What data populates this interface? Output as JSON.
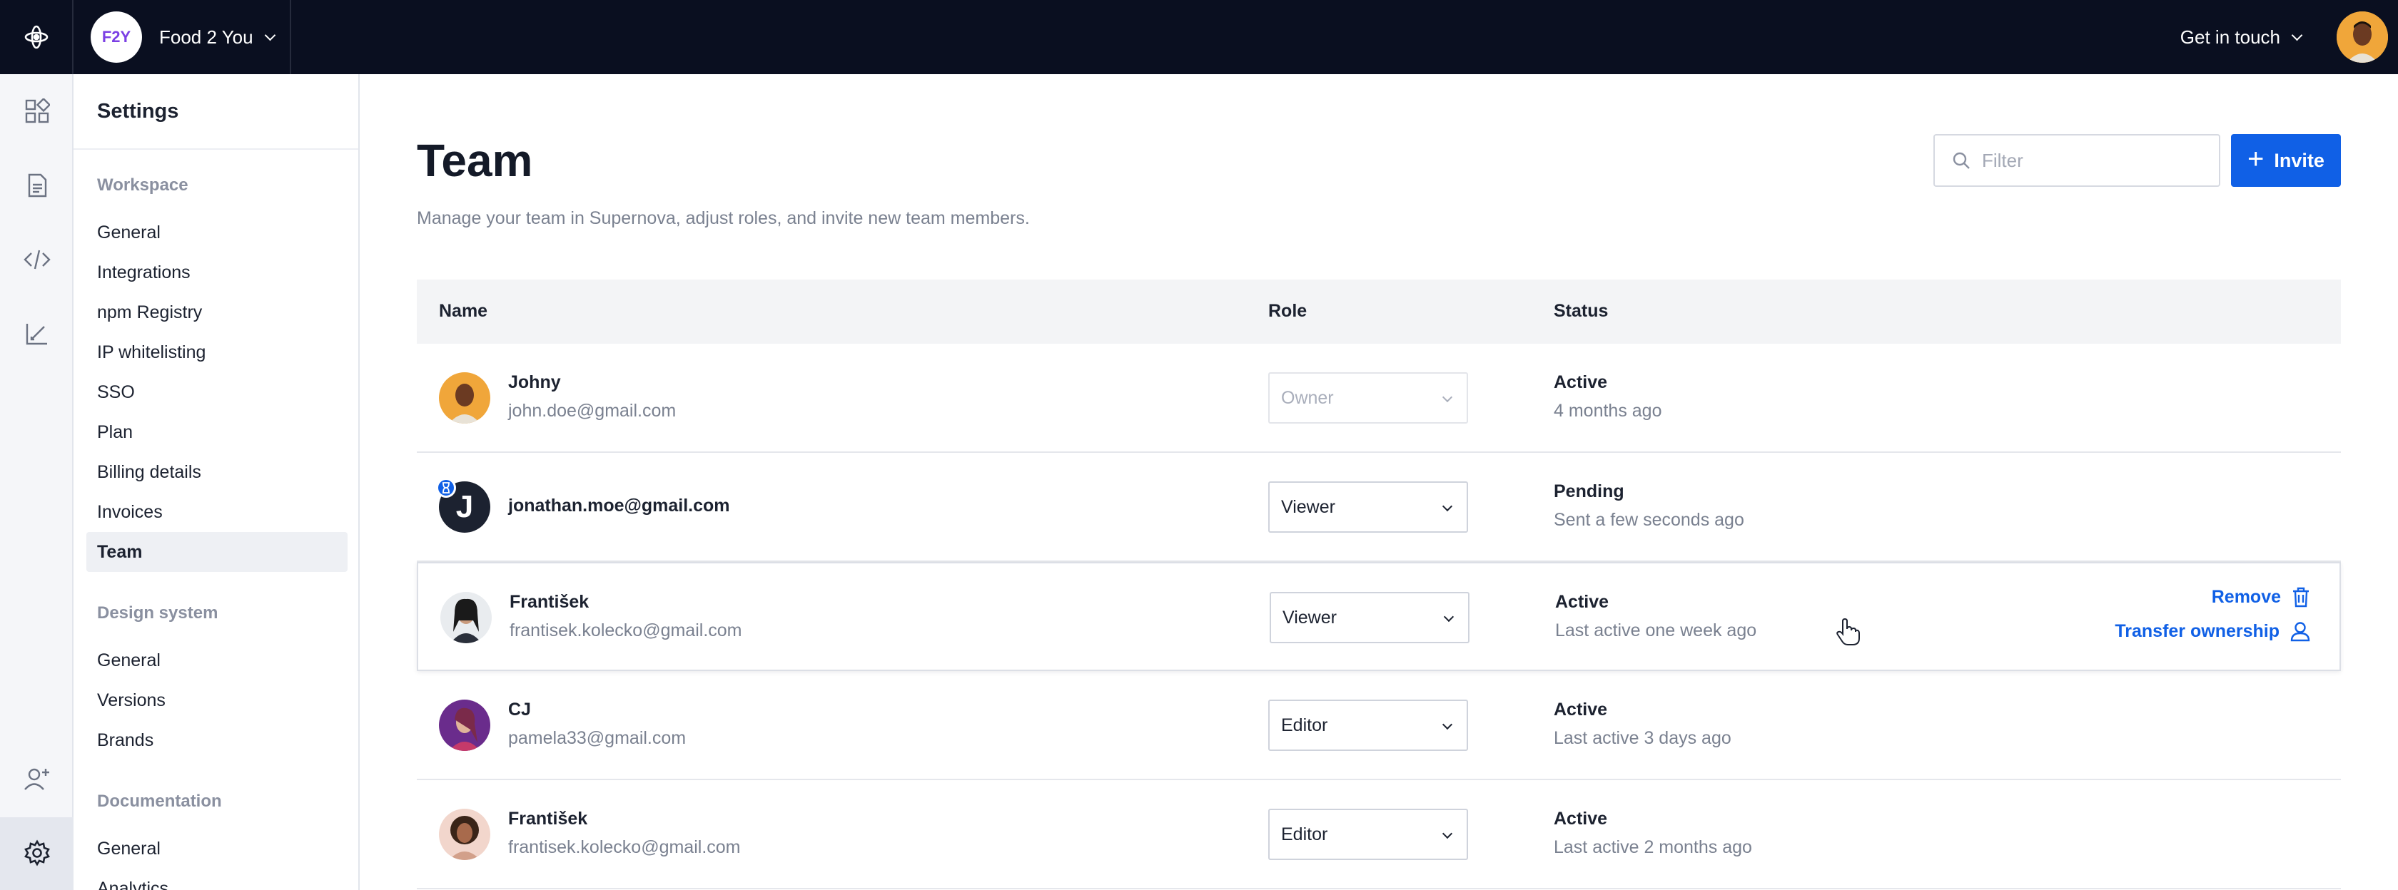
{
  "topbar": {
    "workspace_initials": "F2Y",
    "workspace_name": "Food 2 You",
    "get_in_touch": "Get in touch"
  },
  "sidebar": {
    "title": "Settings",
    "sections": [
      {
        "label": "Workspace",
        "items": [
          "General",
          "Integrations",
          "npm Registry",
          "IP whitelisting",
          "SSO",
          "Plan",
          "Billing details",
          "Invoices",
          "Team"
        ]
      },
      {
        "label": "Design system",
        "items": [
          "General",
          "Versions",
          "Brands"
        ]
      },
      {
        "label": "Documentation",
        "items": [
          "General",
          "Analytics"
        ]
      }
    ],
    "active_item": "Team"
  },
  "main": {
    "title": "Team",
    "subtitle": "Manage your team in Supernova, adjust roles, and invite new team members.",
    "filter_placeholder": "Filter",
    "invite_label": "Invite",
    "columns": [
      "Name",
      "Role",
      "Status"
    ],
    "rows": [
      {
        "name": "Johny",
        "email": "john.doe@gmail.com",
        "role": "Owner",
        "status": "Active",
        "status_detail": "4 months ago"
      },
      {
        "name": "",
        "email": "jonathan.moe@gmail.com",
        "avatar_letter": "J",
        "role": "Viewer",
        "status": "Pending",
        "status_detail": "Sent a few seconds ago"
      },
      {
        "name": "František",
        "email": "frantisek.kolecko@gmail.com",
        "role": "Viewer",
        "status": "Active",
        "status_detail": "Last active one week ago",
        "actions": [
          "Remove",
          "Transfer ownership"
        ]
      },
      {
        "name": "CJ",
        "email": "pamela33@gmail.com",
        "role": "Editor",
        "status": "Active",
        "status_detail": "Last active 3 days ago"
      },
      {
        "name": "František",
        "email": "frantisek.kolecko@gmail.com",
        "role": "Editor",
        "status": "Active",
        "status_detail": "Last active 2 months ago"
      }
    ]
  },
  "colors": {
    "topbar_bg": "#0a0f20",
    "accent": "#1060e6",
    "rail_bg": "#f5f6f9"
  }
}
